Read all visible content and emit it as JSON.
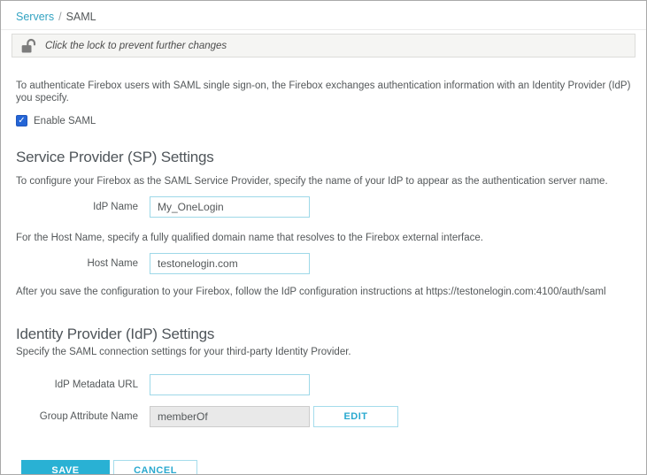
{
  "breadcrumb": {
    "link": "Servers",
    "separator": "/",
    "current": "SAML"
  },
  "lock_bar": {
    "message": "Click the lock to prevent further changes",
    "icon": "unlocked-padlock-icon"
  },
  "intro": "To authenticate Firebox users with SAML single sign-on, the Firebox exchanges authentication information with an Identity Provider (IdP) you specify.",
  "enable_checkbox": {
    "label": "Enable SAML",
    "checked": true,
    "check_glyph": "✓"
  },
  "sp_section": {
    "title": "Service Provider (SP) Settings",
    "description": "To configure your Firebox as the SAML Service Provider, specify the name of your IdP to appear as the authentication server name.",
    "idp_name": {
      "label": "IdP Name",
      "value": "My_OneLogin"
    },
    "host_note": "For the Host Name, specify a fully qualified domain name that resolves to the Firebox external interface.",
    "host_name": {
      "label": "Host Name",
      "value": "testonelogin.com"
    },
    "post_note": "After you save the configuration to your Firebox, follow the IdP configuration instructions at https://testonelogin.com:4100/auth/saml"
  },
  "idp_section": {
    "title": "Identity Provider (IdP) Settings",
    "description": "Specify the SAML connection settings for your third-party Identity Provider.",
    "metadata_url": {
      "label": "IdP Metadata URL",
      "value": ""
    },
    "group_attribute": {
      "label": "Group Attribute Name",
      "value": "memberOf",
      "edit_label": "EDIT"
    }
  },
  "actions": {
    "save": "SAVE",
    "cancel": "CANCEL"
  },
  "colors": {
    "accent": "#29b1d4",
    "link": "#33a3c2",
    "checkbox_blue": "#2465d6",
    "text": "#54585a",
    "input_border": "#9ed8e8",
    "lockbar_bg": "#f5f5f3"
  }
}
